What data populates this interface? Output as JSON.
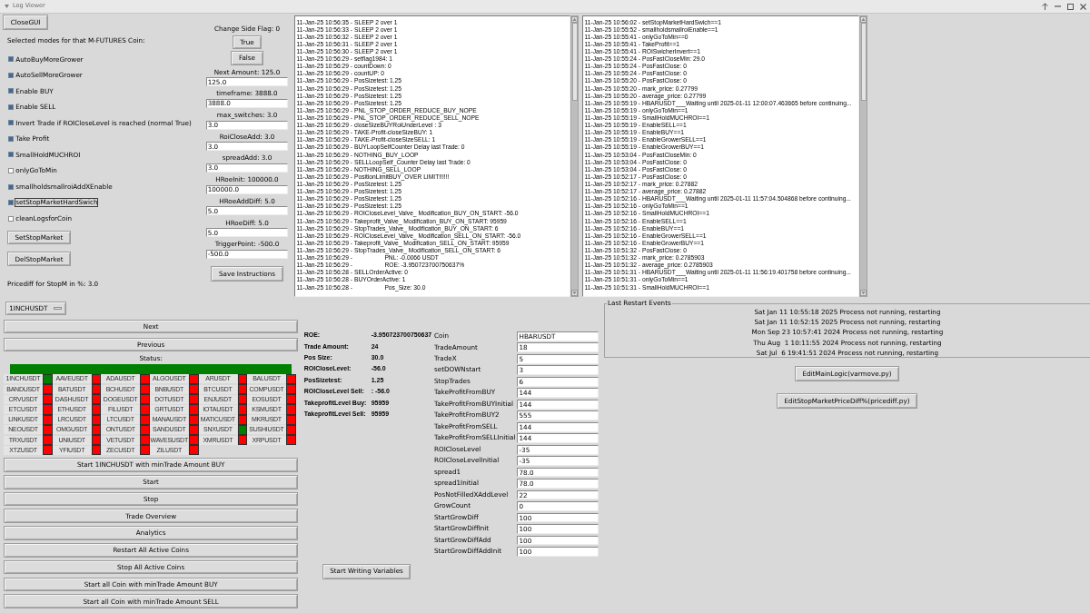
{
  "window": {
    "title": "Log Viewer"
  },
  "close_button": "CloseGUI",
  "modes": {
    "heading": "Selected modes for that M-FUTURES Coin:",
    "items": [
      {
        "label": "AutoBuyMoreGrower",
        "checked": true,
        "focused": false
      },
      {
        "label": "AutoSellMoreGrower",
        "checked": true,
        "focused": false
      },
      {
        "label": "Enable BUY",
        "checked": true,
        "focused": false
      },
      {
        "label": "Enable SELL",
        "checked": true,
        "focused": false
      },
      {
        "label": "Invert Trade if ROICloseLevel is reached (normal True)",
        "checked": true,
        "focused": false
      },
      {
        "label": "Take Profit",
        "checked": true,
        "focused": false
      },
      {
        "label": "SmallHoldMUCHROI",
        "checked": true,
        "focused": false
      },
      {
        "label": "onlyGoToMin",
        "checked": false,
        "focused": false
      },
      {
        "label": "smallholdsmallroiAddXEnable",
        "checked": true,
        "focused": false
      },
      {
        "label": "setStopMarketHardSwich",
        "checked": true,
        "focused": true
      },
      {
        "label": "cleanLogsforCoin",
        "checked": false,
        "focused": false
      }
    ]
  },
  "stop_market_buttons": [
    "SetStopMarket",
    "DelStopMarket"
  ],
  "pricediff": "Pricediff for StopM in %: 3.0",
  "side_flag": {
    "label": "Change Side Flag: 0",
    "buttons": [
      "True",
      "False"
    ]
  },
  "settings": [
    {
      "kind": "caption",
      "text": "Next Amount: 125.0"
    },
    {
      "kind": "field",
      "value": "125.0"
    },
    {
      "kind": "caption",
      "text": "timeframe: 3888.0"
    },
    {
      "kind": "field",
      "value": "3888.0"
    },
    {
      "kind": "caption",
      "text": "max_switches: 3.0"
    },
    {
      "kind": "field",
      "value": "3.0"
    },
    {
      "kind": "caption",
      "text": "RoiCloseAdd: 3.0"
    },
    {
      "kind": "field",
      "value": "3.0"
    },
    {
      "kind": "caption",
      "text": "spreadAdd: 3.0"
    },
    {
      "kind": "field",
      "value": "3.0"
    },
    {
      "kind": "caption",
      "text": "HRoeInit: 100000.0"
    },
    {
      "kind": "field",
      "value": "100000.0"
    },
    {
      "kind": "caption",
      "text": "HRoeAddDiff: 5.0"
    },
    {
      "kind": "field",
      "value": "5.0"
    },
    {
      "kind": "caption",
      "text": "HRoeDiff: 5.0"
    },
    {
      "kind": "field",
      "value": "5.0"
    },
    {
      "kind": "caption",
      "text": "TriggerPoint: -500.0"
    },
    {
      "kind": "field",
      "value": "-500.0"
    }
  ],
  "save_button": "Save Instructions",
  "logs": [
    {
      "lines": [
        "11-Jan-25 10:56:35 - SLEEP 2 over 1",
        "11-Jan-25 10:56:33 - SLEEP 2 over 1",
        "11-Jan-25 10:56:32 - SLEEP 2 over 1",
        "11-Jan-25 10:56:31 - SLEEP 2 over 1",
        "11-Jan-25 10:56:30 - SLEEP 2 over 1",
        "11-Jan-25 10:56:29 - setflag1984: 1",
        "11-Jan-25 10:56:29 - countDown: 0",
        "11-Jan-25 10:56:29 - countUP: 0",
        "11-Jan-25 10:56:29 - PosSizetest: 1.25",
        "11-Jan-25 10:56:29 - PosSizetest: 1.25",
        "11-Jan-25 10:56:29 - PosSizetest: 1.25",
        "11-Jan-25 10:56:29 - PosSizetest: 1.25",
        "11-Jan-25 10:56:29 - PNL_STOP_ORDER_REDUCE_BUY_NOPE",
        "11-Jan-25 10:56:29 - PNL_STOP_ORDER_REDUCE_SELL_NOPE",
        "11-Jan-25 10:56:29 - closeSizeBUYRoiUnderLevel : 3",
        "11-Jan-25 10:56:29 - TAKE-Profit-closeSizeBUY: 1",
        "11-Jan-25 10:56:29 - TAKE-Profit-closeSizeSELL: 1",
        "11-Jan-25 10:56:29 - BUYLoopSelfCounter Delay last Trade: 0",
        "11-Jan-25 10:56:29 - NOTHING_BUY_LOOP",
        "11-Jan-25 10:56:29 - SELLLoopSelf_Counter Delay last Trade: 0",
        "11-Jan-25 10:56:29 - NOTHING_SELL_LOOP",
        "11-Jan-25 10:56:29 - PositionLimitBUY_OVER LIMIT!!!!!!",
        "11-Jan-25 10:56:29 - PosSizetest: 1.25",
        "11-Jan-25 10:56:29 - PosSizetest: 1.25",
        "11-Jan-25 10:56:29 - PosSizetest: 1.25",
        "11-Jan-25 10:56:29 - PosSizetest: 1.25",
        "11-Jan-25 10:56:29 - ROICloseLevel_Valve_ Modification_BUY_ON_START: -56.0",
        "11-Jan-25 10:56:29 - Takeprofit_Valve_ Modification_BUY_ON_START: 95959",
        "11-Jan-25 10:56:29 - StopTrades_Valve_ Modification_BUY_ON_START: 6",
        "11-Jan-25 10:56:29 - ROICloseLevel_Valve_ Modification_SELL_ON_START: -56.0",
        "11-Jan-25 10:56:29 - Takeprofit_Valve_ Modification_SELL_ON_START: 95959",
        "11-Jan-25 10:56:29 - StopTrades_Valve_ Modification_SELL_ON_START: 6",
        "11-Jan-25 10:56:29 -                   PNL: -0.0066 USDT",
        "11-Jan-25 10:56:29 -                   ROE: -3.950723700750637%",
        "11-Jan-25 10:56:28 - SELLOrderActive: 0",
        "11-Jan-25 10:56:28 - BUYOrderActive: 1",
        "11-Jan-25 10:56:28 -                   Pos_Size: 30.0"
      ]
    },
    {
      "lines": [
        "11-Jan-25 10:56:02 - setStopMarketHardSwich==1",
        "11-Jan-25 10:55:52 - smallholdsmallroiEnable==1",
        "11-Jan-25 10:55:41 - onlyGoToMin==0",
        "11-Jan-25 10:55:41 - TakeProfit==1",
        "11-Jan-25 10:55:41 - ROISwicherInvert==1",
        "11-Jan-25 10:55:24 - PosFastCloseMin: 29.0",
        "11-Jan-25 10:55:24 - PosFastClose: 0",
        "11-Jan-25 10:55:24 - PosFastClose: 0",
        "11-Jan-25 10:55:20 - PosFastClose: 0",
        "11-Jan-25 10:55:20 - mark_price: 0.27799",
        "11-Jan-25 10:55:20 - average_price: 0.27799",
        "11-Jan-25 10:55:19 - HBARUSDT___Waiting until 2025-01-11 12:00:07.463665 before continuing...",
        "11-Jan-25 10:55:19 - onlyGoToMin==1",
        "11-Jan-25 10:55:19 - SmallHoldMUCHROI==1",
        "11-Jan-25 10:55:19 - EnableSELL==1",
        "11-Jan-25 10:55:19 - EnableBUY==1",
        "11-Jan-25 10:55:19 - EnableGrowerSELL==1",
        "11-Jan-25 10:55:19 - EnableGrowerBUY==1",
        "11-Jan-25 10:53:04 - PosFastCloseMin: 0",
        "11-Jan-25 10:53:04 - PosFastClose: 0",
        "11-Jan-25 10:53:04 - PosFastClose: 0",
        "11-Jan-25 10:52:17 - PosFastClose: 0",
        "11-Jan-25 10:52:17 - mark_price: 0.27882",
        "11-Jan-25 10:52:17 - average_price: 0.27882",
        "11-Jan-25 10:52:16 - HBARUSDT___Waiting until 2025-01-11 11:57:04.504868 before continuing...",
        "11-Jan-25 10:52:16 - onlyGoToMin==1",
        "11-Jan-25 10:52:16 - SmallHoldMUCHROI==1",
        "11-Jan-25 10:52:16 - EnableSELL==1",
        "11-Jan-25 10:52:16 - EnableBUY==1",
        "11-Jan-25 10:52:16 - EnableGrowerSELL==1",
        "11-Jan-25 10:52:16 - EnableGrowerBUY==1",
        "11-Jan-25 10:51:32 - PosFastClose: 0",
        "11-Jan-25 10:51:32 - mark_price: 0.2785903",
        "11-Jan-25 10:51:32 - average_price: 0.2785903",
        "11-Jan-25 10:51:31 - HBARUSDT___Waiting until 2025-01-11 11:56:19.401758 before continuing...",
        "11-Jan-25 10:51:31 - onlyGoToMin==1",
        "11-Jan-25 10:51:31 - SmallHoldMUCHROI==1"
      ]
    }
  ],
  "coin_select": {
    "value": "1INCHUSDT"
  },
  "nav_buttons": [
    "Next",
    "Previous"
  ],
  "status": {
    "label": "Status:",
    "color": "#008000",
    "coins": [
      {
        "name": "1INCHUSDT",
        "color": "#008000"
      },
      {
        "name": "AAVEUSDT",
        "color": "#ff0000"
      },
      {
        "name": "ADAUSDT",
        "color": "#ff0000"
      },
      {
        "name": "ALGOUSDT",
        "color": "#ff0000"
      },
      {
        "name": "ARUSDT",
        "color": "#ff0000"
      },
      {
        "name": "BALUSDT",
        "color": "#ff0000"
      },
      {
        "name": "BANDUSDT",
        "color": "#ff0000"
      },
      {
        "name": "BATUSDT",
        "color": "#ff0000"
      },
      {
        "name": "BCHUSDT",
        "color": "#ff0000"
      },
      {
        "name": "BNBUSDT",
        "color": "#ff0000"
      },
      {
        "name": "BTCUSDT",
        "color": "#ff0000"
      },
      {
        "name": "COMPUSDT",
        "color": "#ff0000"
      },
      {
        "name": "CRVUSDT",
        "color": "#ff0000"
      },
      {
        "name": "DASHUSDT",
        "color": "#ff0000"
      },
      {
        "name": "DOGEUSDT",
        "color": "#ff0000"
      },
      {
        "name": "DOTUSDT",
        "color": "#ff0000"
      },
      {
        "name": "ENJUSDT",
        "color": "#ff0000"
      },
      {
        "name": "EOSUSDT",
        "color": "#ff0000"
      },
      {
        "name": "ETCUSDT",
        "color": "#ff0000"
      },
      {
        "name": "ETHUSDT",
        "color": "#ff0000"
      },
      {
        "name": "FILUSDT",
        "color": "#ff0000"
      },
      {
        "name": "GRTUSDT",
        "color": "#ff0000"
      },
      {
        "name": "IOTAUSDT",
        "color": "#ff0000"
      },
      {
        "name": "KSMUSDT",
        "color": "#ff0000"
      },
      {
        "name": "LINKUSDT",
        "color": "#ff0000"
      },
      {
        "name": "LRCUSDT",
        "color": "#ff0000"
      },
      {
        "name": "LTCUSDT",
        "color": "#ff0000"
      },
      {
        "name": "MANAUSDT",
        "color": "#ff0000"
      },
      {
        "name": "MATICUSDT",
        "color": "#ff0000"
      },
      {
        "name": "MKRUSDT",
        "color": "#ff0000"
      },
      {
        "name": "NEOUSDT",
        "color": "#ff0000"
      },
      {
        "name": "OMGUSDT",
        "color": "#ff0000"
      },
      {
        "name": "ONTUSDT",
        "color": "#ff0000"
      },
      {
        "name": "SANDUSDT",
        "color": "#ff0000"
      },
      {
        "name": "SNXUSDT",
        "color": "#008000"
      },
      {
        "name": "SUSHIUSDT",
        "color": "#ff0000"
      },
      {
        "name": "TRXUSDT",
        "color": "#ff0000"
      },
      {
        "name": "UNIUSDT",
        "color": "#ff0000"
      },
      {
        "name": "VETUSDT",
        "color": "#ff0000"
      },
      {
        "name": "WAVESUSDT",
        "color": "#ff0000"
      },
      {
        "name": "XMRUSDT",
        "color": "#ff0000"
      },
      {
        "name": "XRPUSDT",
        "color": "#ff0000"
      },
      {
        "name": "XTZUSDT",
        "color": "#ff0000"
      },
      {
        "name": "YFIUSDT",
        "color": "#ff0000"
      },
      {
        "name": "ZECUSDT",
        "color": "#ff0000"
      },
      {
        "name": "ZILUSDT",
        "color": "#ff0000"
      }
    ]
  },
  "action_buttons": [
    "Start 1INCHUSDT with minTrade Amount BUY",
    "Start",
    "Stop",
    "Trade Overview",
    "Analytics",
    "Restart All Active Coins",
    "Stop All Active Coins",
    "Start all Coin with minTrade Amount BUY",
    "Start all Coin with minTrade Amount SELL"
  ],
  "position_info": [
    {
      "label": "ROE:",
      "value": "-3.950723700750637"
    },
    {
      "label": "Trade Amount:",
      "value": "24"
    },
    {
      "label": "Pos Size:",
      "value": "30.0"
    },
    {
      "label": "ROICloseLevel:",
      "value": "-56.0"
    },
    {
      "label": "PosSizetest:",
      "value": "1.25"
    },
    {
      "label": "ROICloseLevel Sell:",
      "value": ": -56.0"
    },
    {
      "label": "TakeprofitLevel Buy:",
      "value": "95959"
    },
    {
      "label": "TakeprofitLevel Sell:",
      "value": "95959"
    }
  ],
  "variables": [
    {
      "label": "Coin",
      "value": "HBARUSDT"
    },
    {
      "label": "TradeAmount",
      "value": "18"
    },
    {
      "label": "TradeX",
      "value": "5"
    },
    {
      "label": "setDOWNstart",
      "value": "3"
    },
    {
      "label": "StopTrades",
      "value": "6"
    },
    {
      "label": "TakeProfitFromBUY",
      "value": "144"
    },
    {
      "label": "TakeProfitFromBUYInitial",
      "value": "144"
    },
    {
      "label": "TakeProfitFromBUY2",
      "value": "555"
    },
    {
      "label": "TakeProfitFromSELL",
      "value": "144"
    },
    {
      "label": "TakeProfitFromSELLInitial",
      "value": "144"
    },
    {
      "label": "ROICloseLevel",
      "value": "-35"
    },
    {
      "label": "ROICloseLevelInitial",
      "value": "-35"
    },
    {
      "label": "spread1",
      "value": "78.0"
    },
    {
      "label": "spread1Initial",
      "value": "78.0"
    },
    {
      "label": "PosNotFilledXAddLevel",
      "value": "22"
    },
    {
      "label": "GrowCount",
      "value": "0"
    },
    {
      "label": "StartGrowDiff",
      "value": "100"
    },
    {
      "label": "StartGrowDiffInit",
      "value": "100"
    },
    {
      "label": "StartGrowDiffAdd",
      "value": "100"
    },
    {
      "label": "StartGrowDiffAddInit",
      "value": "100"
    }
  ],
  "write_button": "Start Writing Variables",
  "restart_events": {
    "title": "Last Restart Events",
    "events": [
      "Sat Jan 11 10:55:18 2025 Process not running, restarting",
      "Sat Jan 11 10:52:15 2025 Process not running, restarting",
      "Mon Sep 23 10:57:41 2024 Process not running, restarting",
      "Thu Aug  1 10:11:55 2024 Process not running, restarting",
      "Sat Jul  6 19:41:51 2024 Process not running, restarting"
    ]
  },
  "edit_buttons": [
    "EditMainLogic(varmove.py)",
    "EditStopMarketPriceDiff%(pricediff.py)"
  ]
}
